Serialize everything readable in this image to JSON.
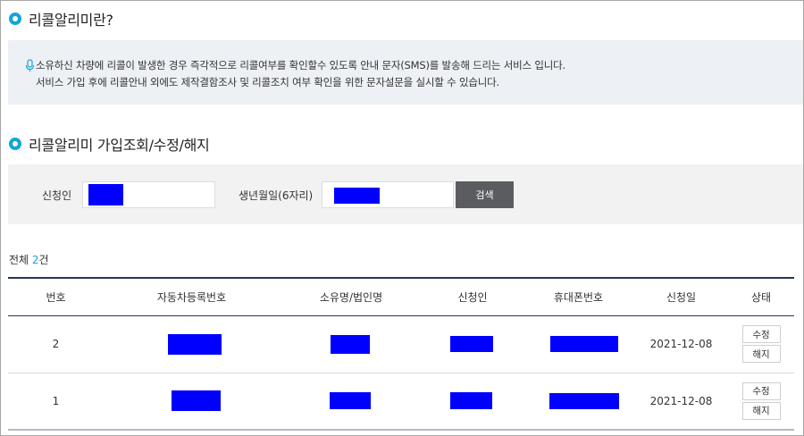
{
  "sections": {
    "intro_title": "리콜알리미란?",
    "lookup_title": "리콜알리미 가입조회/수정/해지"
  },
  "notice": {
    "icon": "microphone-icon",
    "line1": "소유하신 차량에 리콜이 발생한 경우 즉각적으로 리콜여부를 확인할수 있도록 안내 문자(SMS)를 발송해 드리는 서비스 입니다.",
    "line2": "서비스 가입 후에 리콜안내 외에도 제작결함조사 및 리콜조치 여부 확인을 위한 문자설문을 실시할 수 있습니다."
  },
  "search": {
    "applicant_label": "신청인",
    "birth_label": "생년월일(6자리)",
    "search_button": "검색"
  },
  "summary": {
    "total_prefix": "전체 ",
    "total_count": "2",
    "total_suffix": "건"
  },
  "table": {
    "headers": [
      "번호",
      "자동차등록번호",
      "소유명/법인명",
      "신청인",
      "휴대폰번호",
      "신청일",
      "상태"
    ],
    "rows": [
      {
        "no": "2",
        "date": "2021-12-08",
        "edit": "수정",
        "cancel": "해지"
      },
      {
        "no": "1",
        "date": "2021-12-08",
        "edit": "수정",
        "cancel": "해지"
      }
    ]
  },
  "colors": {
    "accent": "#14a5d8",
    "header_rule": "#24345d",
    "redaction": "#0000ff",
    "search_button_bg": "#5a5c60"
  }
}
